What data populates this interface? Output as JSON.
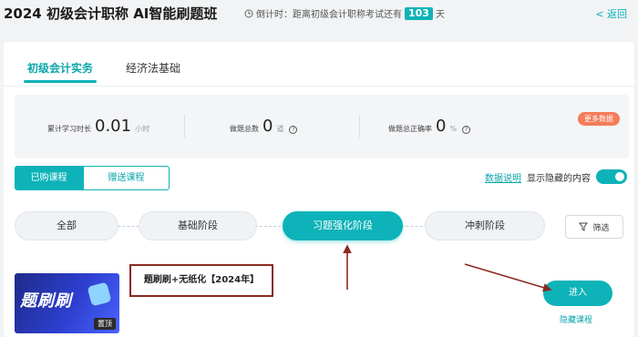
{
  "header": {
    "title": "2024 初级会计职称 AI智能刷题班",
    "countdown_prefix": "倒计时：距离初级会计职称考试还有",
    "countdown_days": "103",
    "countdown_suffix": "天",
    "back_label": "< 返回"
  },
  "tabs": [
    {
      "label": "初级会计实务",
      "active": true
    },
    {
      "label": "经济法基础",
      "active": false
    }
  ],
  "stats": {
    "study_time": {
      "label": "累计学习时长",
      "value": "0.01",
      "unit": "小时"
    },
    "questions_done": {
      "label": "做题总数",
      "value": "0",
      "unit": "道"
    },
    "accuracy": {
      "label": "做题总正确率",
      "value": "0",
      "unit": "%"
    },
    "more_label": "更多数据",
    "help_icon_glyph": "?"
  },
  "segments": [
    {
      "label": "已购课程",
      "active": true
    },
    {
      "label": "赠送课程",
      "active": false
    }
  ],
  "links": {
    "data_explain": "数据说明",
    "show_hidden": "显示隐藏的内容"
  },
  "stages": [
    {
      "label": "全部",
      "active": false
    },
    {
      "label": "基础阶段",
      "active": false
    },
    {
      "label": "习题强化阶段",
      "active": true
    },
    {
      "label": "冲刺阶段",
      "active": false
    }
  ],
  "filter_label": "筛选",
  "course": {
    "thumb_text": "题刷刷",
    "pinned_badge": "置顶",
    "name": "题刷刷+无纸化【2024年】",
    "enter_label": "进入",
    "hide_label": "隐藏课程"
  },
  "colors": {
    "accent": "#0db3b8",
    "orange": "#f47c5a",
    "annotation": "#8b2a1f"
  }
}
